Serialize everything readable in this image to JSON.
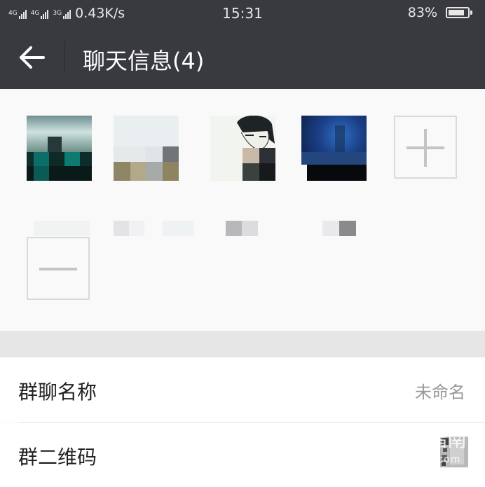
{
  "status_bar": {
    "network_1": "4G",
    "network_2": "4G",
    "network_3": "3G",
    "speed": "0.43K/s",
    "time": "15:31",
    "battery_text": "83%",
    "battery_level": 0.83
  },
  "header": {
    "title": "聊天信息(4)"
  },
  "members": {
    "add_icon": "plus-icon",
    "remove_icon": "minus-icon"
  },
  "rows": {
    "group_name_label": "群聊名称",
    "group_name_value": "未命名",
    "qr_code_label": "群二维码"
  },
  "watermark": {
    "brand": "搜狗指南",
    "url": "zhinan.sogou.com"
  }
}
